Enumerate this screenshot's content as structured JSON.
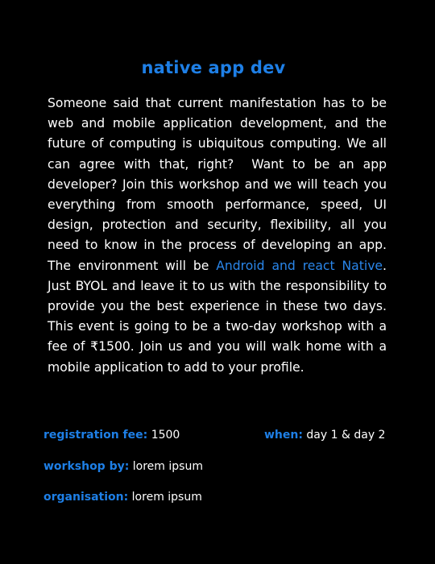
{
  "title": "native app dev",
  "description": {
    "part1": "Someone said that current manifestation has to be web and mobile application development, and the future of computing is ubiquitous computing. We all can agree with that, right?  Want to be an app developer? Join this workshop and we will teach you everything from smooth performance, speed, UI design, protection and security, flexibility, all you need to know in the process of developing an app. The environment will be ",
    "highlight": "Android and react Native",
    "part2": ". Just BYOL and leave it to us with the responsibility to provide you the best experience in these two days. This event is going to be a two-day workshop with a fee of ₹1500. Join us and you will walk home with a mobile application to add to your profile."
  },
  "details": {
    "registration_fee": {
      "label": "registration fee:",
      "value": "1500"
    },
    "when": {
      "label": "when:",
      "value": "day 1 & day 2"
    },
    "workshop_by": {
      "label": "workshop by:",
      "value": "lorem ipsum"
    },
    "organisation": {
      "label": "organisation:",
      "value": "lorem ipsum"
    }
  },
  "colors": {
    "background": "#000000",
    "accent": "#1e7fe6",
    "text": "#ffffff"
  }
}
